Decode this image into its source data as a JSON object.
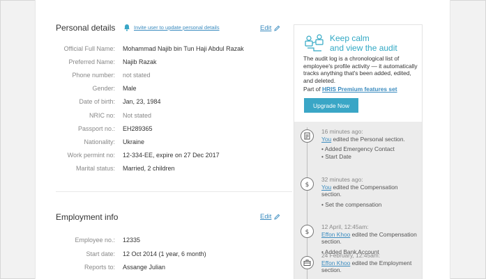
{
  "personal": {
    "title": "Personal details",
    "notify_label": "Invite user to update personal details",
    "edit_label": "Edit",
    "fields": [
      {
        "label": "Official Full Name:",
        "value": "Mohammad Najib bin Tun Haji Abdul Razak"
      },
      {
        "label": "Preferred Name:",
        "value": "Najib Razak"
      },
      {
        "label": "Phone number:",
        "value": "not stated"
      },
      {
        "label": "Gender:",
        "value": "Male"
      },
      {
        "label": "Date of birth:",
        "value": "Jan, 23, 1984"
      },
      {
        "label": "NRIC no:",
        "value": "Not stated"
      },
      {
        "label": "Passport no.:",
        "value": "EH289365"
      },
      {
        "label": "Nationality:",
        "value": "Ukraine"
      },
      {
        "label": "Work permint no:",
        "value": "12-334-EE, expire on 27 Dec 2017"
      },
      {
        "label": "Marital status:",
        "value": "Married, 2 children"
      }
    ]
  },
  "employment": {
    "title": "Employment info",
    "edit_label": "Edit",
    "fields": [
      {
        "label": "Employee no.:",
        "value": "12335"
      },
      {
        "label": "Start date:",
        "value": "12 Oct 2014 (1 year, 6 month)"
      },
      {
        "label": "Reports to:",
        "value": "Assange Julian"
      }
    ]
  },
  "promo": {
    "title_line1": "Keep calm",
    "title_line2": "and view the audit",
    "description": "The audit log is a chronological list of employee's profile activity — it automatically tracks anything that's been added, edited, and deleted.",
    "part_of_prefix": "Part of",
    "part_of_link": "HRIS Premium features set",
    "button_label": "Upgrade Now"
  },
  "timeline": [
    {
      "icon": "document-icon",
      "time": "16 minutes ago:",
      "who": "You",
      "action": " edited the Personal section.",
      "items": [
        "Added Emergency Contact",
        "Start Date"
      ]
    },
    {
      "icon": "dollar-icon",
      "time": "32 minutes ago:",
      "who": "You",
      "action": " edited the Compensation section.",
      "items": [
        "Set the compensation"
      ]
    },
    {
      "icon": "dollar-icon",
      "time": "12 April, 12:45am:",
      "who": "Effon Khoo",
      "action": "  edited the Compensation section.",
      "items": [
        "Added Bank Account"
      ]
    },
    {
      "icon": "briefcase-icon",
      "time": "24 February, 12:45am:",
      "who": "Effon Khoo",
      "action": " edited the Employment section.",
      "items": []
    }
  ],
  "colors": {
    "accent": "#3aa6c6",
    "link": "#3a8bbf",
    "panel_bg": "#ececec"
  }
}
